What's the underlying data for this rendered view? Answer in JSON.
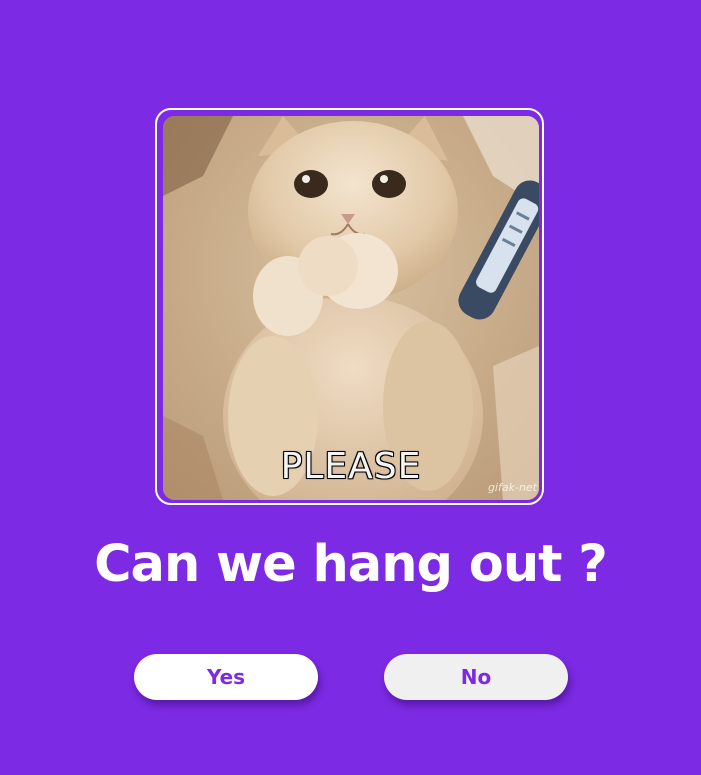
{
  "image": {
    "caption": "PLEASE",
    "watermark": "gifak-net"
  },
  "question": "Can we hang out ?",
  "buttons": {
    "yes_label": "Yes",
    "no_label": "No"
  },
  "colors": {
    "background": "#7d2ae4",
    "button_text": "#7d2ae4",
    "frame_border": "#ffffff"
  }
}
